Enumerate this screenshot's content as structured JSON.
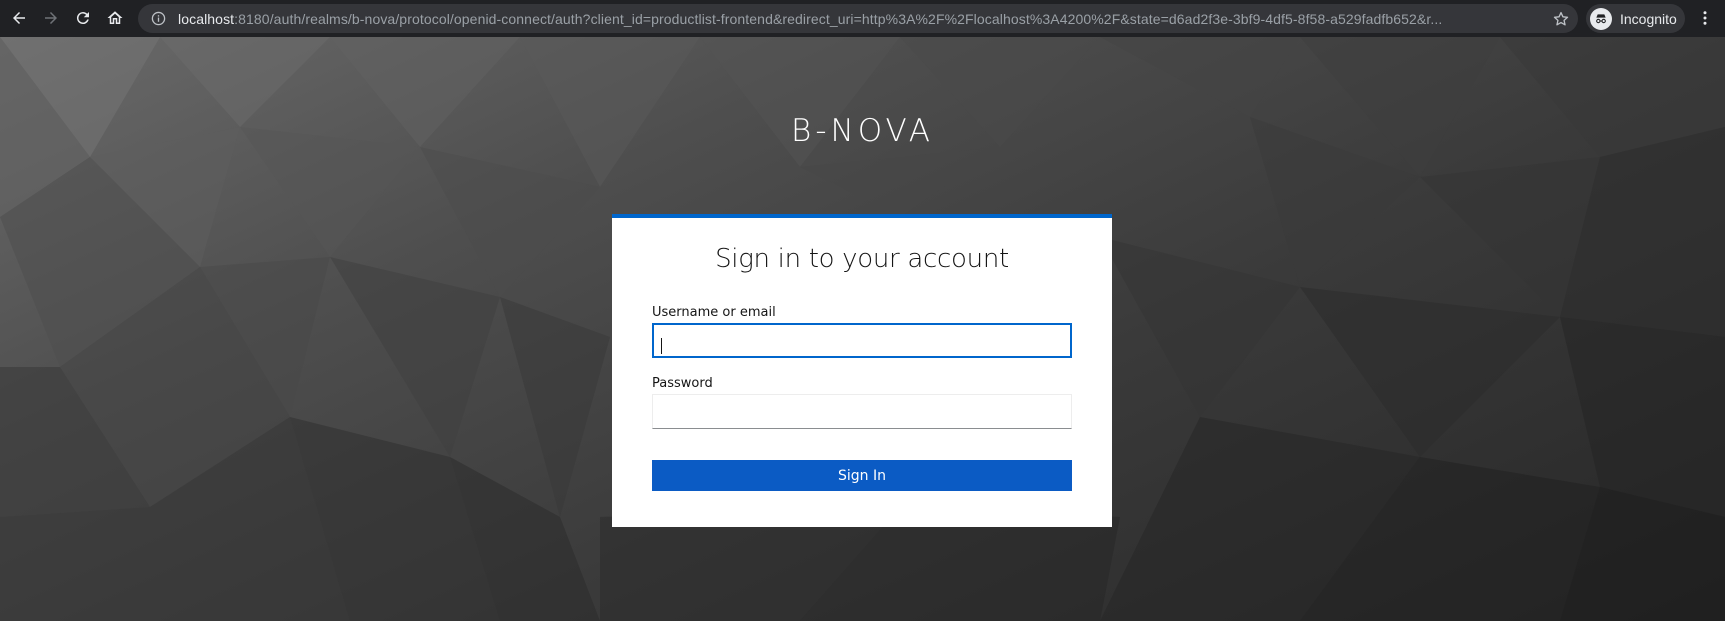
{
  "browser": {
    "url_host": "localhost",
    "url_rest": ":8180/auth/realms/b-nova/protocol/openid-connect/auth?client_id=productlist-frontend&redirect_uri=http%3A%2F%2Flocalhost%3A4200%2F&state=d6ad2f3e-3bf9-4df5-8f58-a529fadfb652&r...",
    "profile_label": "Incognito",
    "icons": {
      "back": "back-arrow-icon",
      "forward": "forward-arrow-icon",
      "reload": "reload-icon",
      "home": "home-icon",
      "info": "info-icon",
      "bookmark": "star-icon",
      "profile": "incognito-icon",
      "menu": "kebab-menu-icon"
    }
  },
  "page": {
    "brand": "B-NOVA",
    "login": {
      "title": "Sign in to your account",
      "username_label": "Username or email",
      "username_value": "",
      "password_label": "Password",
      "password_value": "",
      "submit_label": "Sign In"
    }
  },
  "colors": {
    "accent": "#0066cc",
    "button": "#0b5bc4",
    "chrome": "#202124",
    "omnibox": "#35363a"
  }
}
